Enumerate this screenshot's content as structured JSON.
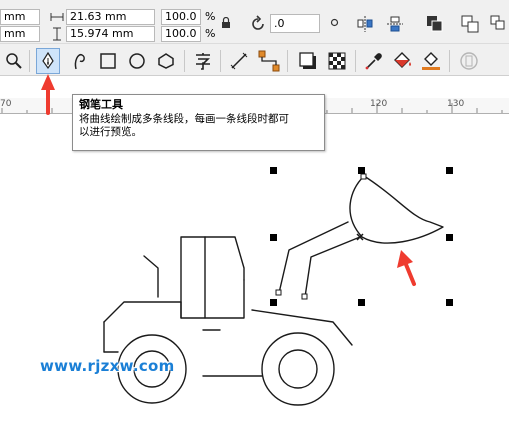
{
  "property_bar": {
    "x_unit_partial": "mm",
    "y_unit_partial": "mm",
    "width_value": "21.63 mm",
    "height_value": "15.974 mm",
    "scale_x": "100.0",
    "scale_y": "100.0",
    "percent_symbol": "%",
    "rotation_value": ".0"
  },
  "toolbox": {
    "active_tool": "pen-tool"
  },
  "ruler": {
    "labels": [
      "70",
      "120",
      "130"
    ]
  },
  "tooltip": {
    "title": "钢笔工具",
    "body_line1": "将曲线绘制成多条线段，每画一条线段时都可",
    "body_line2": "以进行预览。"
  },
  "watermark": "www.rjzxw.com",
  "colors": {
    "accent_arrow": "#ef3b2f",
    "watermark": "#1a7fd6"
  }
}
